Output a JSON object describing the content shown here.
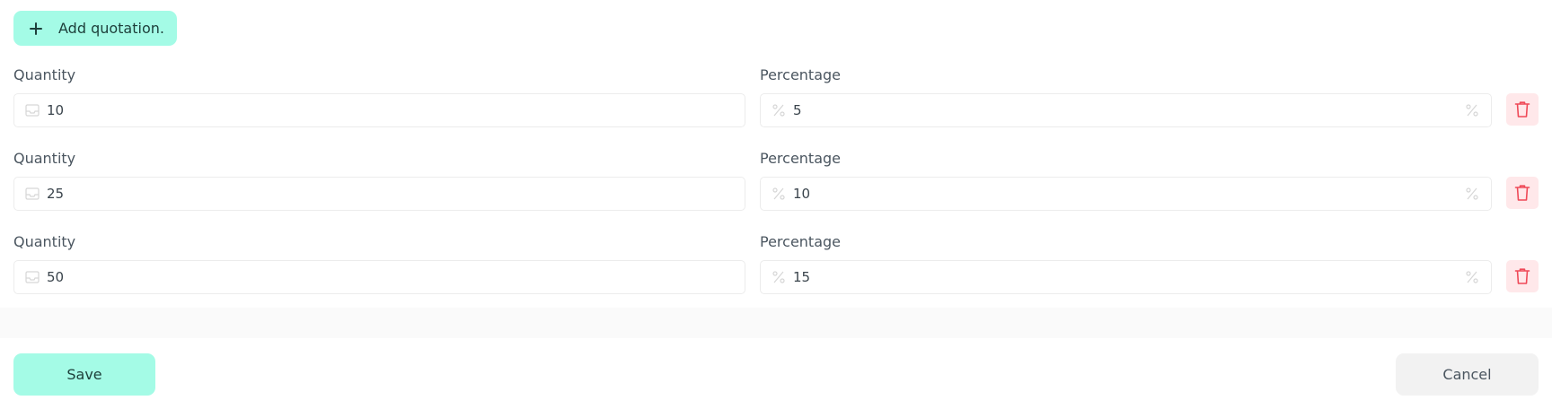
{
  "toolbar": {
    "add_label": "Add quotation."
  },
  "quotations": [
    {
      "quantity_label": "Quantity",
      "quantity_value": "10",
      "percentage_label": "Percentage",
      "percentage_value": "5"
    },
    {
      "quantity_label": "Quantity",
      "quantity_value": "25",
      "percentage_label": "Percentage",
      "percentage_value": "10"
    },
    {
      "quantity_label": "Quantity",
      "quantity_value": "50",
      "percentage_label": "Percentage",
      "percentage_value": "15"
    }
  ],
  "icons": {
    "add": "plus-icon",
    "quantity": "inbox-icon",
    "percentage": "percent-icon",
    "delete": "trash-icon"
  },
  "footer": {
    "save_label": "Save",
    "cancel_label": "Cancel"
  },
  "colors": {
    "accent": "#a4fbe6",
    "danger": "#ef4957",
    "danger_bg": "#ffe8ea"
  }
}
